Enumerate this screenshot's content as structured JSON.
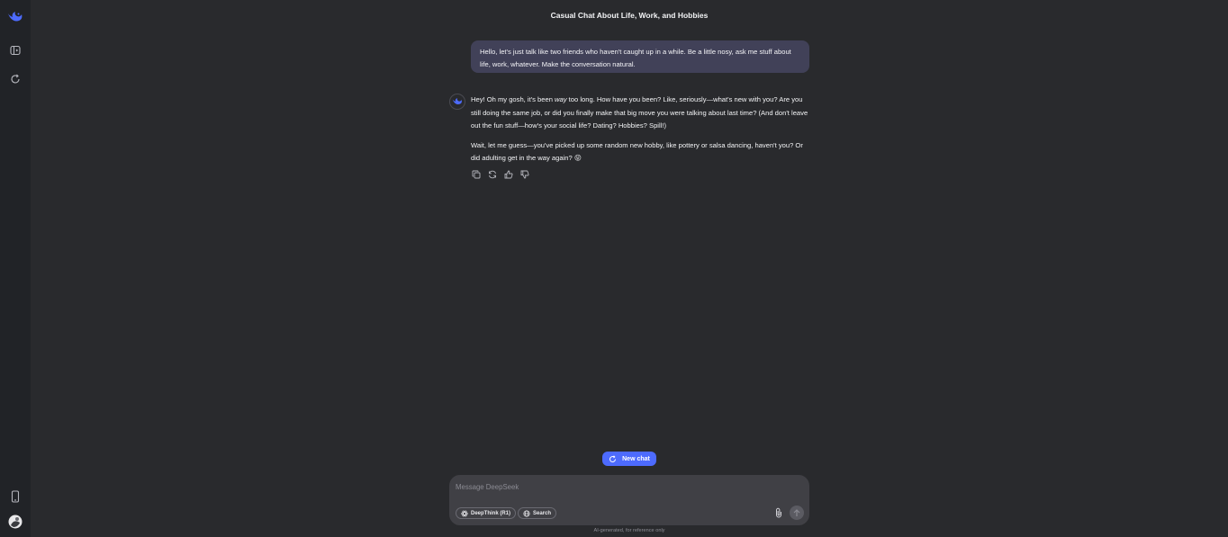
{
  "chat": {
    "title": "Casual Chat About Life, Work, and Hobbies",
    "user_message": "Hello, let's just talk like two friends who haven't caught up in a while. Be a little nosy, ask me stuff about life, work, whatever. Make the conversation natural.",
    "ai_paragraph_1_a": "Hey! Oh my gosh, it's been ",
    "ai_paragraph_1_em": "way",
    "ai_paragraph_1_b": " too long. How have you been? Like, seriously—what's new with you? Are you still doing the same job, or did you finally make that big move you were talking about last time? (And don't leave out the fun stuff—how's your social life? Dating? Hobbies? Spill!)",
    "ai_paragraph_2": "Wait, let me guess—you've picked up some random new hobby, like pottery or salsa dancing, haven't you? Or did adulting get in the way again? 😜"
  },
  "new_chat_label": "New chat",
  "composer": {
    "placeholder": "Message DeepSeek",
    "deepthink_label": "DeepThink (R1)",
    "search_label": "Search"
  },
  "footer_note": "AI-generated, for reference only",
  "colors": {
    "accent": "#4d6bfe",
    "background": "#292a2d",
    "sidebar": "#212327",
    "user_bubble": "#414158",
    "composer": "#404045"
  },
  "icons": {
    "logo": "deepseek-whale-icon",
    "sidebar_toggle": "sidebar-toggle-icon",
    "new_chat": "new-chat-icon",
    "mobile": "mobile-phone-icon",
    "avatar": "user-avatar-icon"
  }
}
